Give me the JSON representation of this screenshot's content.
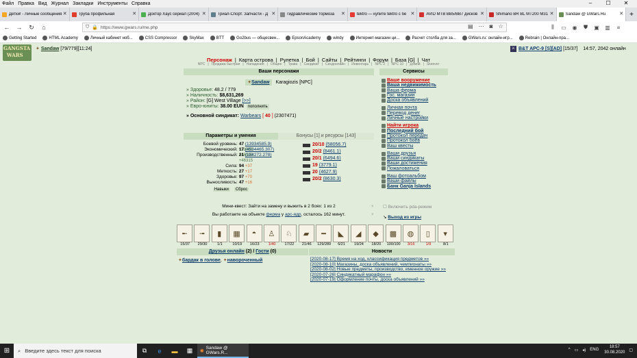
{
  "menubar": [
    "Файл",
    "Правка",
    "Вид",
    "Журнал",
    "Закладки",
    "Инструменты",
    "Справка"
  ],
  "tabs": [
    {
      "label": "Детки! - Личные сообщения",
      "color": "#f5a623"
    },
    {
      "label": "Труба профильная",
      "color": "#e03e2d"
    },
    {
      "label": "Доктор Хаус сериал (2004)",
      "color": "#4caf50"
    },
    {
      "label": "Триал-Спорт. Запчасти - Д",
      "color": "#607d8b"
    },
    {
      "label": "гидравлические тормоза",
      "color": "#888888"
    },
    {
      "label": "tektro — купите tektro с бе",
      "color": "#e53935"
    },
    {
      "label": "AVID MTB BB5/BB7 дисков",
      "color": "#d32f2f"
    },
    {
      "label": "Shimano BR BL MT200 M31",
      "color": "#c62828"
    },
    {
      "label": "Sandaw @ GWars.Ru",
      "color": "#6a8f55"
    }
  ],
  "url": "https://www.gwars.ru/me.php",
  "bookmarks": [
    "Getting Started",
    "HTML Academy",
    "Личный кабинет ноб...",
    "CSS Compressor",
    "SkyMax",
    "BTT",
    "Go2bus — общесвен...",
    "EpsonAcademy",
    "windy",
    "Интернет-магазин ци...",
    "Расчет столба для за...",
    "GWars.ru: онлайн-игр...",
    "Rebrain | Онлайн-пра..."
  ],
  "logo": "GANGSTA WARS",
  "topleft": {
    "name": "Sandaw",
    "stats": "[79/779][11:24]"
  },
  "topright": {
    "clan": "B&T APC-9 [S][AD]",
    "ammo": "[15/37]",
    "time": "14:57, 2042 онлайн"
  },
  "mainnav": [
    "Персонаж",
    "Карта острова",
    "Рулетка",
    "Бой",
    "Сайты",
    "Рейтинги",
    "Форум",
    "База [G]",
    "Чат"
  ],
  "subnav": [
    "NPC",
    "Продажа быстрая",
    "Нападения",
    "Общее",
    "Трава",
    "Синдикат",
    "Синдонлайн",
    "Инвентарь",
    "NPC 2",
    "NPC 10",
    "Домой",
    "Skeever"
  ],
  "persons": {
    "header": "Ваши персонажи",
    "name": "Sandaw",
    "npc": "Karagiozis [NPC]",
    "health_lbl": "» Здоровье:",
    "health": "48.2 / 779",
    "cash_lbl": "» Наличность:",
    "cash": "$8,631,269",
    "area_lbl": "» Район:",
    "area": "[G] West Village",
    "area_link": "[>>]",
    "euro_lbl": "» Евро-юниты:",
    "euro": "38.00 EUN",
    "euro_btn": "пополнить",
    "synd_lbl": "» Основной синдикат:",
    "synd": "Warbears",
    "synd_num": "40",
    "synd_id": "(2307471)"
  },
  "services": {
    "header": "Сервисы",
    "items": [
      "Ваше вооружение",
      "Ваша недвижимость",
      "Ваша ферма",
      "Гос. магазин",
      "Доска объявлений",
      "",
      "Личная почта",
      "Перевод денег",
      "Личные настройки",
      "",
      "Найти игрока",
      "Последний бой",
      "Протокол передач",
      "Протокол боёв",
      "Ваш квесты",
      "",
      "Ваши друзья",
      "Ваши синдикаты",
      "Ваши достижения",
      "Пожаловаться",
      "",
      "Ваш фотоальбом",
      "Ваши файлы",
      "Банк Ganja Islands"
    ]
  },
  "params": {
    "header": "Параметры и умения",
    "bonus_header": "Бонусы [1] и ресурсы [143]",
    "rows": [
      {
        "k": "Боевой уровень:",
        "v": "47",
        "x": "(13934585.9)",
        "s": "+31086"
      },
      {
        "k": "Экономический:",
        "v": "17",
        "x": "(4534465.307)",
        "s": "+46903"
      },
      {
        "k": "Производственный:",
        "v": "21",
        "x": "(184272.278)",
        "s": "+46315"
      },
      {
        "k": "",
        "v": "",
        "x": "",
        "s": ""
      },
      {
        "k": "Сила:",
        "v": "94",
        "x": "",
        "s": "+37"
      },
      {
        "k": "Меткость:",
        "v": "27",
        "x": "",
        "s": "+17"
      },
      {
        "k": "Здоровье:",
        "v": "97",
        "x": "",
        "s": "+70"
      },
      {
        "k": "Выносливость:",
        "v": "47",
        "x": "",
        "s": "+16"
      }
    ],
    "btn1": "Навыки",
    "btn2": "Сброс",
    "bonuses": [
      {
        "v": "20/10",
        "x": "(58056.7)"
      },
      {
        "v": "20/2",
        "x": "(8461.1)"
      },
      {
        "v": "20/1",
        "x": "(6494.6)"
      },
      {
        "v": "19",
        "x": "(3779.1)"
      },
      {
        "v": "20",
        "x": "(4627.9)"
      },
      {
        "v": "20/2",
        "x": "(8630.3)"
      }
    ]
  },
  "quest": {
    "line1": "Мини-квест: Зайти на замену и выжить в 2 боях: 1 из 2",
    "line2_a": "Вы работаете на объекте",
    "line2_b": "ферма",
    "line2_c": "у",
    "line2_d": "арс-ядр",
    "line2_e": ", осталось 162 минут.",
    "pda": "Включить pda-режим",
    "exit": "Выход из игры"
  },
  "items": [
    "15/37",
    "29/30",
    "1/1",
    "10/19",
    "16/23",
    "1/40",
    "17/22",
    "21/46",
    "129/289",
    "6/21",
    "19/24",
    "18/20",
    "100/100",
    "3/16",
    "1/9",
    "8/1"
  ],
  "friends": {
    "header_a": "Друзья онлайн",
    "header_b": "(2)",
    "header_c": "Гости",
    "header_d": "(0)",
    "list": [
      "бардак в голове",
      "навороченный"
    ]
  },
  "news": {
    "header": "Новости",
    "items": [
      "[2020-08-17] Время на ход, классификация предметов »»",
      "[2020-08-10] Магазины, доска объявлений, чемпионаты »»",
      "[2020-08-02] Новые предметы, производство, именное оружие »»",
      "[2020-07-26] Синдикатный марафон »»",
      "[2020-07-19] Оформление почты, доска объявлений »»"
    ]
  },
  "taskbar": {
    "search": "Введите здесь текст для поиска",
    "active": "Sandaw @ GWars.R...",
    "lang": "ENG",
    "time": "18:57",
    "date": "30.08.2020"
  }
}
